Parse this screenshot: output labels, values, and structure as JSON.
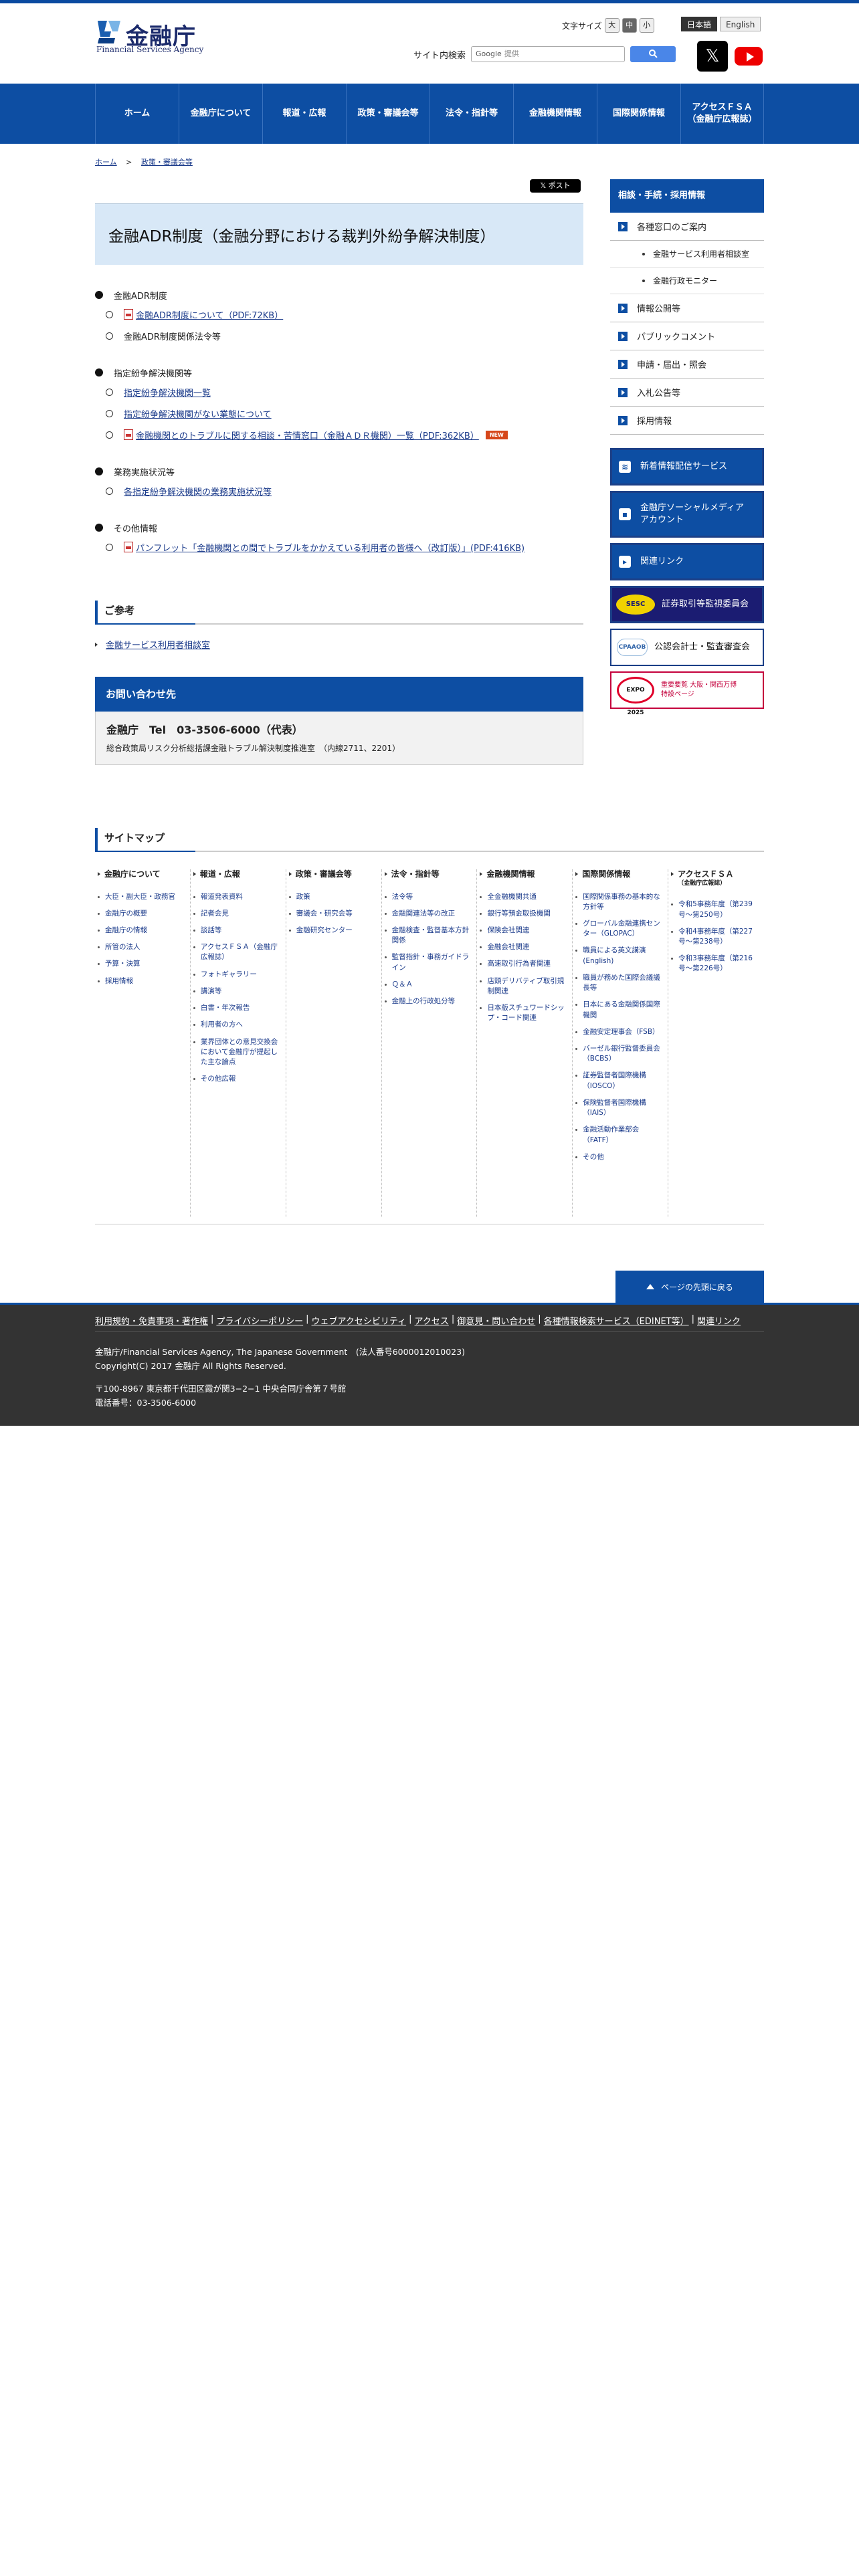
{
  "header": {
    "logo_text": "金融庁",
    "logo_sub": "Financial Services Agency",
    "text_size_label": "文字サイズ",
    "text_sizes": [
      "大",
      "中",
      "小"
    ],
    "lang_ja": "日本語",
    "lang_en": "English",
    "site_search_label": "サイト内検索",
    "search_google": "Google",
    "search_placeholder": "提供",
    "search_button_icon": "search-icon",
    "sns_x": "X",
    "sns_youtube": "YouTube"
  },
  "gnav": [
    "ホーム",
    "金融庁について",
    "報道・広報",
    "政策・審議会等",
    "法令・指針等",
    "金融機関情報",
    "国際関係情報",
    "アクセスＦＳＡ\n（金融庁広報誌）"
  ],
  "breadcrumb": {
    "home": "ホーム",
    "sep": ">",
    "current": "政策・審議会等"
  },
  "xpost": "𝕏 ポスト",
  "page_title": "金融ADR制度（金融分野における裁判外紛争解決制度）",
  "sections": [
    {
      "heading": "金融ADR制度",
      "items": [
        {
          "text": "金融ADR制度について（PDF:72KB）",
          "link": true,
          "pdf": true,
          "new": false
        },
        {
          "text": "金融ADR制度関係法令等",
          "link": false,
          "pdf": false,
          "new": false
        }
      ]
    },
    {
      "heading": "指定紛争解決機関等",
      "items": [
        {
          "text": "指定紛争解決機関一覧",
          "link": true,
          "pdf": false,
          "new": false
        },
        {
          "text": "指定紛争解決機関がない業態について",
          "link": true,
          "pdf": false,
          "new": false
        },
        {
          "text": "金融機関とのトラブルに関する相談・苦情窓口（金融ＡＤＲ機関）一覧（PDF:362KB）",
          "link": true,
          "pdf": true,
          "new": true
        }
      ]
    },
    {
      "heading": "業務実施状況等",
      "items": [
        {
          "text": "各指定紛争解決機関の業務実施状況等",
          "link": true,
          "pdf": false,
          "new": false
        }
      ]
    },
    {
      "heading": "その他情報",
      "items": [
        {
          "text": "パンフレット「金融機関との間でトラブルをかかえている利用者の皆様へ（改訂版）」(PDF:416KB)",
          "link": true,
          "pdf": true,
          "new": false
        }
      ]
    }
  ],
  "new_badge": "NEW",
  "reference": {
    "heading": "ご参考",
    "link": "金融サービス利用者相談室"
  },
  "contact": {
    "heading": "お問い合わせ先",
    "line1": "金融庁　Tel　03-3506-6000（代表）",
    "line2": "総合政策局リスク分析総括課金融トラブル解決制度推進室　（内線2711、2201）"
  },
  "sidebar": {
    "heading": "相談・手続・採用情報",
    "items": [
      {
        "label": "各種窓口のご案内",
        "subs": [
          "金融サービス利用者相談室",
          "金融行政モニター"
        ]
      },
      {
        "label": "情報公開等",
        "subs": []
      },
      {
        "label": "パブリックコメント",
        "subs": []
      },
      {
        "label": "申請・届出・照会",
        "subs": []
      },
      {
        "label": "入札公告等",
        "subs": []
      },
      {
        "label": "採用情報",
        "subs": []
      }
    ],
    "banners": {
      "news": "新着情報配信サービス",
      "social": "金融庁ソーシャルメディア\nアカウント",
      "links": "関連リンク",
      "sesc_logo": "SESC",
      "sesc": "証券取引等監視委員会",
      "cpa_logo": "CPAAOB",
      "cpa": "公認会計士・監査審査会",
      "expo_logo": "EXPO 2025",
      "expo": "重要要覧 大阪・関西万博\n特設ページ"
    }
  },
  "sitemap": {
    "heading": "サイトマップ",
    "columns": [
      {
        "title": "金融庁について",
        "subtitle": "",
        "links": [
          "大臣・副大臣・政務官",
          "金融庁の概要",
          "金融庁の情報",
          "所管の法人",
          "予算・決算",
          "採用情報"
        ]
      },
      {
        "title": "報道・広報",
        "subtitle": "",
        "links": [
          "報道発表資料",
          "記者会見",
          "談話等",
          "アクセスＦＳＡ（金融庁広報誌）",
          "フォトギャラリー",
          "講演等",
          "白書・年次報告",
          "利用者の方へ",
          "業界団体との意見交換会において金融庁が提起した主な論点",
          "その他広報"
        ]
      },
      {
        "title": "政策・審議会等",
        "subtitle": "",
        "links": [
          "政策",
          "審議会・研究会等",
          "金融研究センター"
        ]
      },
      {
        "title": "法令・指針等",
        "subtitle": "",
        "links": [
          "法令等",
          "金融関連法等の改正",
          "金融検査・監督基本方針関係",
          "監督指針・事務ガイドライン",
          "Ｑ＆Ａ",
          "金融上の行政処分等"
        ]
      },
      {
        "title": "金融機関情報",
        "subtitle": "",
        "links": [
          "全金融機関共通",
          "銀行等預金取扱機関",
          "保険会社関連",
          "金融会社関連",
          "高速取引行為者関連",
          "店頭デリバティブ取引規制関連",
          "日本版スチュワードシップ・コード関連"
        ]
      },
      {
        "title": "国際関係情報",
        "subtitle": "",
        "links": [
          "国際関係事務の基本的な方針等",
          "グローバル金融連携センター（GLOPAC）",
          "職員による英文講演(English)",
          "職員が務めた国際会議議長等",
          "日本にある金融関係国際機関",
          "金融安定理事会（FSB）",
          "バーゼル銀行監督委員会（BCBS）",
          "証券監督者国際機構（IOSCO）",
          "保険監督者国際機構（IAIS）",
          "金融活動作業部会（FATF）",
          "その他"
        ]
      },
      {
        "title": "アクセスＦＳＡ",
        "subtitle": "（金融庁広報誌）",
        "links": [
          "令和5事務年度（第239号〜第250号）",
          "令和4事務年度（第227号〜第238号）",
          "令和3事務年度（第216号〜第226号）"
        ]
      }
    ]
  },
  "pagetop": "ページの先頭に戻る",
  "footer": {
    "links": [
      "利用規約・免責事項・著作権",
      "プライバシーポリシー",
      "ウェブアクセシビリティ",
      "アクセス",
      "御意見・問い合わせ",
      "各種情報検索サービス（EDINET等）",
      "関連リンク"
    ],
    "line1": "金融庁/Financial Services Agency, The Japanese Government　(法人番号6000012010023)",
    "line2": "Copyright(C) 2017 金融庁 All Rights Reserved.",
    "line3": "〒100-8967 東京都千代田区霞が関3−2−1 中央合同庁舎第７号館",
    "line4": "電話番号：03-3506-6000"
  }
}
